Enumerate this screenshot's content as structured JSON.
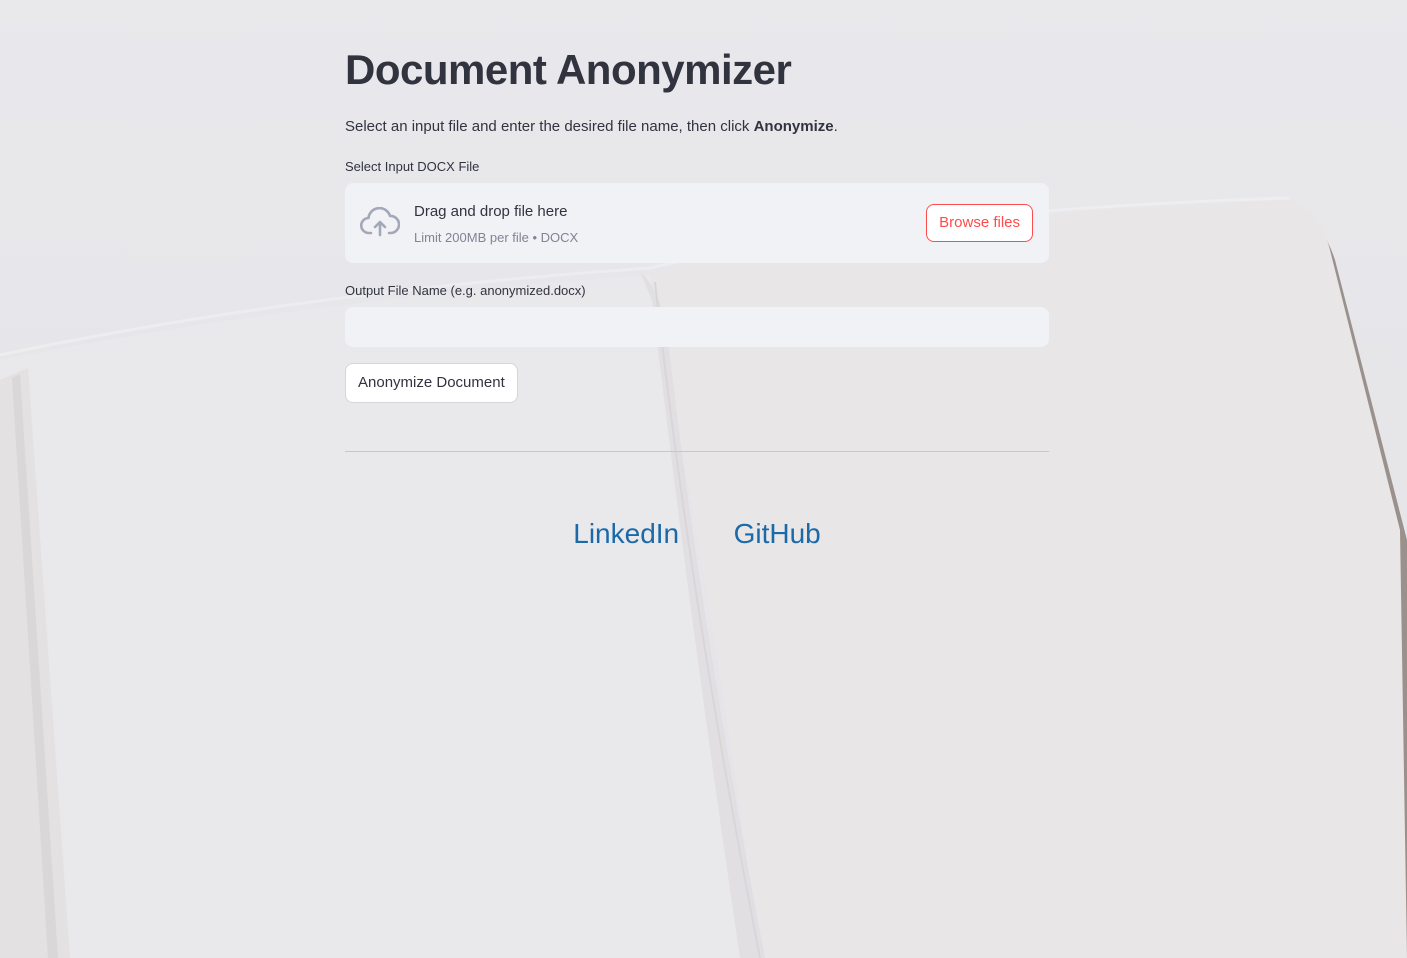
{
  "page": {
    "title": "Document Anonymizer",
    "intro_prefix": "Select an input file and enter the desired file name, then click ",
    "intro_bold": "Anonymize",
    "intro_suffix": "."
  },
  "uploader": {
    "label": "Select Input DOCX File",
    "drop_title": "Drag and drop file here",
    "drop_limit": "Limit 200MB per file • DOCX",
    "browse_label": "Browse files",
    "icon": "cloud-upload-icon"
  },
  "output": {
    "label": "Output File Name (e.g. anonymized.docx)",
    "value": "",
    "placeholder": ""
  },
  "actions": {
    "anonymize_label": "Anonymize Document"
  },
  "footer": {
    "linkedin": "LinkedIn",
    "github": "GitHub"
  },
  "colors": {
    "accent": "#ff4b4b",
    "link": "#1a6aaa",
    "text": "#31333f",
    "muted": "#808495",
    "field_bg": "#f0f2f6"
  }
}
